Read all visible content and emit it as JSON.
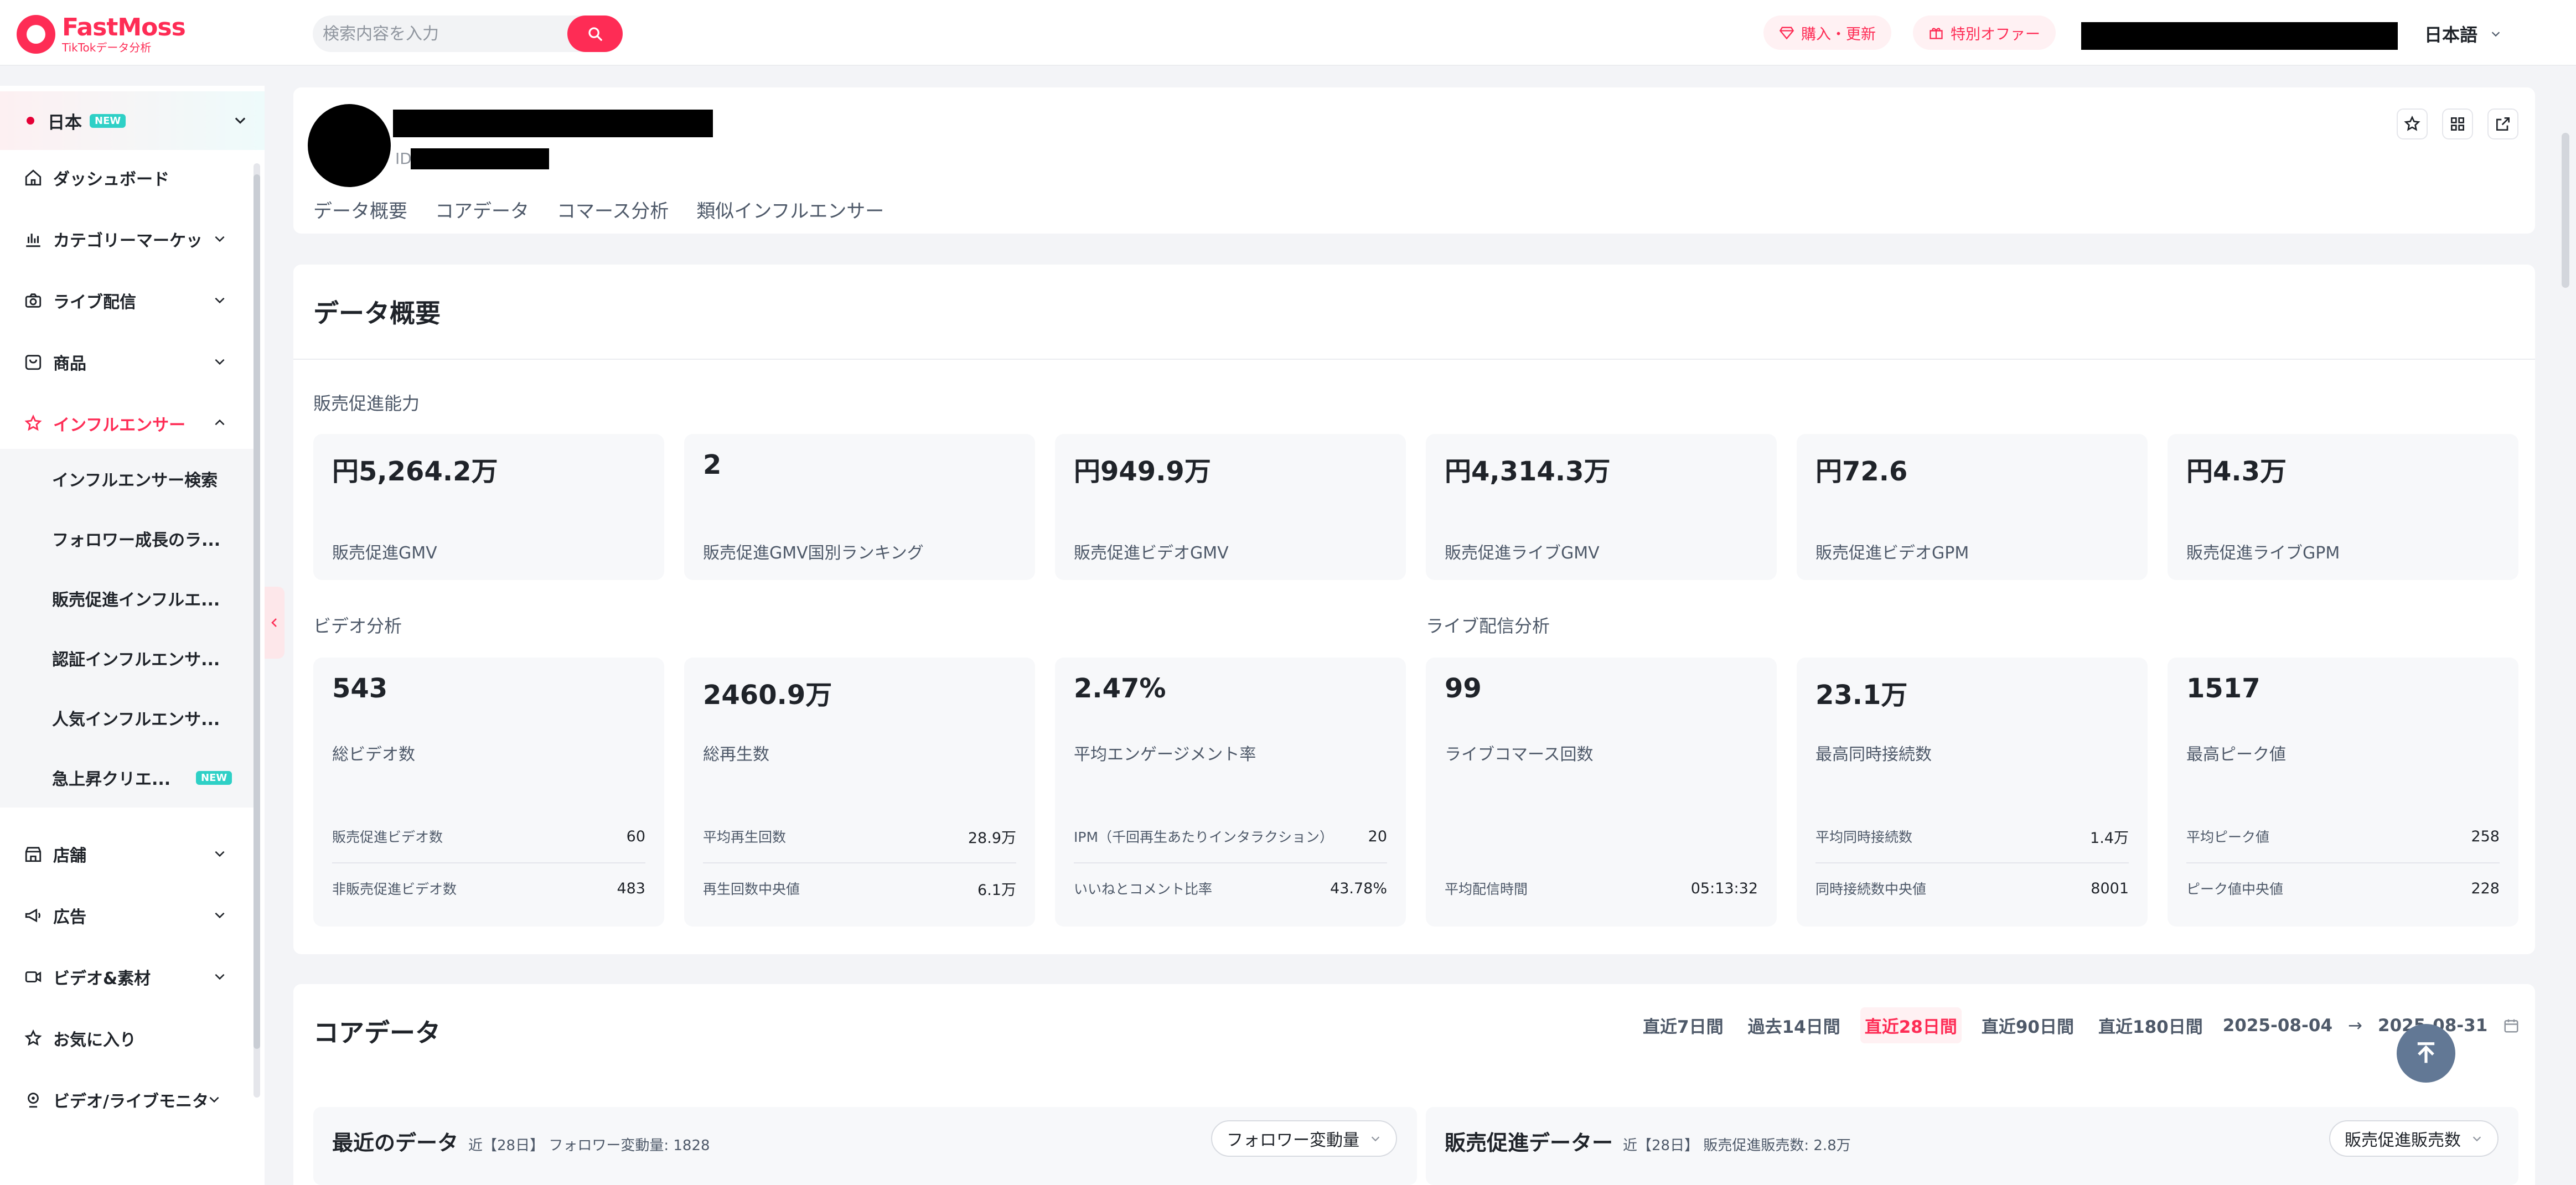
{
  "header": {
    "logo_name": "FastMoss",
    "logo_sub": "TikTokデータ分析",
    "search_placeholder": "検索内容を入力",
    "buy_label": "購入・更新",
    "offer_label": "特別オファー",
    "language": "日本語"
  },
  "sidebar": {
    "country": "日本",
    "country_badge": "NEW",
    "items": [
      {
        "label": "ダッシュボード",
        "icon": "home-icon"
      },
      {
        "label": "カテゴリーマーケッ",
        "icon": "bar-chart-icon"
      },
      {
        "label": "ライブ配信",
        "icon": "camera-icon"
      },
      {
        "label": "商品",
        "icon": "bag-icon"
      },
      {
        "label": "インフルエンサー",
        "icon": "star-icon"
      },
      {
        "label": "店舗",
        "icon": "store-icon"
      },
      {
        "label": "広告",
        "icon": "megaphone-icon"
      },
      {
        "label": "ビデオ&素材",
        "icon": "video-icon"
      },
      {
        "label": "お気に入り",
        "icon": "favorite-icon"
      },
      {
        "label": "ビデオ/ライブモニタ",
        "icon": "monitor-icon"
      }
    ],
    "subitems": [
      "インフルエンサー検索",
      "フォロワー成長のラ...",
      "販売促進インフルエ...",
      "認証インフルエンサ...",
      "人気インフルエンサ...",
      "急上昇クリエ..."
    ],
    "subitem_badge": "NEW"
  },
  "profile": {
    "id_prefix": "ID",
    "tabs": [
      "データ概要",
      "コアデータ",
      "コマース分析",
      "類似インフルエンサー"
    ]
  },
  "overview": {
    "title": "データ概要",
    "sales_group": "販売促進能力",
    "sales_metrics": [
      {
        "value": "円5,264.2万",
        "label": "販売促進GMV"
      },
      {
        "value": "2",
        "label": "販売促進GMV国別ランキング"
      },
      {
        "value": "円949.9万",
        "label": "販売促進ビデオGMV"
      },
      {
        "value": "円4,314.3万",
        "label": "販売促進ライブGMV"
      },
      {
        "value": "円72.6",
        "label": "販売促進ビデオGPM"
      },
      {
        "value": "円4.3万",
        "label": "販売促進ライブGPM"
      }
    ],
    "video_group": "ビデオ分析",
    "live_group": "ライブ配信分析",
    "detail_metrics": [
      {
        "value": "543",
        "label": "総ビデオ数",
        "rows": [
          {
            "k": "販売促進ビデオ数",
            "v": "60"
          },
          {
            "k": "非販売促進ビデオ数",
            "v": "483"
          }
        ]
      },
      {
        "value": "2460.9万",
        "label": "総再生数",
        "rows": [
          {
            "k": "平均再生回数",
            "v": "28.9万"
          },
          {
            "k": "再生回数中央値",
            "v": "6.1万"
          }
        ]
      },
      {
        "value": "2.47%",
        "label": "平均エンゲージメント率",
        "rows": [
          {
            "k": "IPM（千回再生あたりインタラクション）",
            "v": "20"
          },
          {
            "k": "いいねとコメント比率",
            "v": "43.78%"
          }
        ]
      },
      {
        "value": "99",
        "label": "ライブコマース回数",
        "rows": [
          {
            "k": "",
            "v": ""
          },
          {
            "k": "平均配信時間",
            "v": "05:13:32"
          }
        ]
      },
      {
        "value": "23.1万",
        "label": "最高同時接続数",
        "rows": [
          {
            "k": "平均同時接続数",
            "v": "1.4万"
          },
          {
            "k": "同時接続数中央値",
            "v": "8001"
          }
        ]
      },
      {
        "value": "1517",
        "label": "最高ピーク値",
        "rows": [
          {
            "k": "平均ピーク値",
            "v": "258"
          },
          {
            "k": "ピーク値中央値",
            "v": "228"
          }
        ]
      }
    ]
  },
  "core": {
    "title": "コアデータ",
    "ranges": [
      "直近7日間",
      "過去14日間",
      "直近28日間",
      "直近90日間",
      "直近180日間"
    ],
    "selected_range": "直近28日間",
    "date_start": "2025-08-04",
    "date_arrow": "→",
    "date_end": "2025-08-31",
    "recent": {
      "title": "最近のデータ",
      "note": "近【28日】 フォロワー変動量: 1828",
      "dropdown": "フォロワー変動量"
    },
    "sales": {
      "title": "販売促進データー",
      "note": "近【28日】 販売促進販売数: 2.8万",
      "dropdown": "販売促進販売数"
    }
  },
  "colors": {
    "accent": "#fe2c55",
    "teal": "#2ed0c6",
    "totop": "#627895"
  }
}
